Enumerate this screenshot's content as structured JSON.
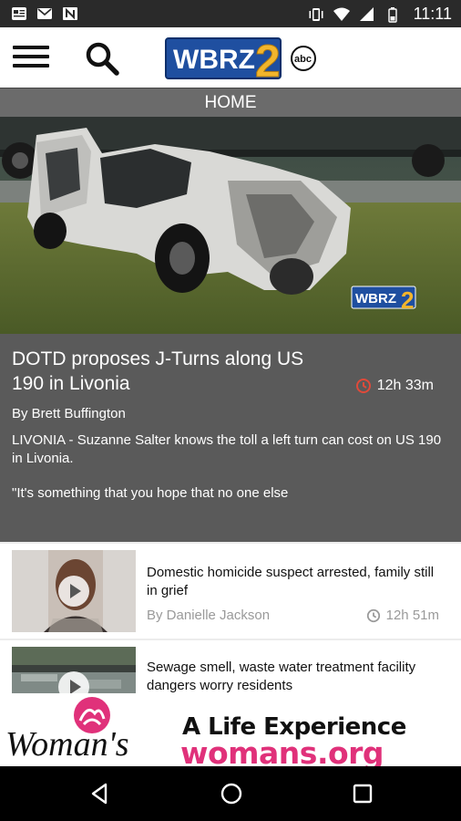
{
  "status_bar": {
    "time": "11:11",
    "left_icons": [
      "news-icon",
      "gmail-icon",
      "n-icon"
    ],
    "right_icons": [
      "vibrate-icon",
      "wifi-icon",
      "signal-icon",
      "battery-icon"
    ]
  },
  "app_bar": {
    "menu_icon": "hamburger-menu-icon",
    "search_icon": "search-icon",
    "logo_text": "WBRZ",
    "logo_number": "2",
    "logo_network": "abc"
  },
  "section": {
    "title": "HOME"
  },
  "hero": {
    "image": "wrecked-white-truck-photo",
    "watermark_text": "WBRZ",
    "watermark_number": "2"
  },
  "featured": {
    "title": "DOTD proposes J-Turns along US 190 in Livonia",
    "time": "12h 33m",
    "time_icon": "clock-icon",
    "byline": "By Brett Buffington",
    "body": "LIVONIA - Suzanne Salter knows the toll a left turn can cost on US 190 in Livonia.",
    "quote": "\"It's something that you hope that no one else"
  },
  "stories": [
    {
      "title": "Domestic homicide suspect arrested, family still in grief",
      "byline": "By Danielle Jackson",
      "time": "12h 51m",
      "thumb": "suspect-mugshot-photo"
    },
    {
      "title": "Sewage smell, waste water treatment facility dangers worry residents",
      "thumb": "treatment-facility-photo"
    }
  ],
  "ad": {
    "brand": "Woman's",
    "tagline": "A Life Experience",
    "url": "womans.org",
    "accent": "#e0317a"
  },
  "nav_bar": {
    "back_icon": "back-triangle-icon",
    "home_icon": "home-circle-icon",
    "recents_icon": "recents-square-icon"
  },
  "colors": {
    "status_bar": "#2a2a2a",
    "section_bar": "#6b6b6b",
    "featured_bg": "#5a5a5a",
    "logo_blue": "#1f4fa0",
    "logo_gold": "#f2b52c",
    "alarm_red": "#e04a3a"
  }
}
